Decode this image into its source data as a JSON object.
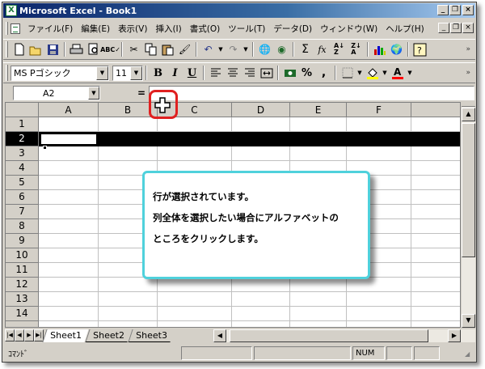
{
  "window": {
    "title": "Microsoft Excel - Book1",
    "app_icon": "excel-icon"
  },
  "menubar": {
    "items": [
      "ファイル(F)",
      "編集(E)",
      "表示(V)",
      "挿入(I)",
      "書式(O)",
      "ツール(T)",
      "データ(D)",
      "ウィンドウ(W)",
      "ヘルプ(H)"
    ]
  },
  "toolbar_standard": {
    "icons": [
      "new-icon",
      "open-icon",
      "save-icon",
      "print-icon",
      "print-preview-icon",
      "spelling-icon",
      "cut-icon",
      "copy-icon",
      "paste-icon",
      "format-painter-icon",
      "undo-icon",
      "redo-icon",
      "hyperlink-icon",
      "web-icon",
      "autosum-icon",
      "function-icon",
      "sort-ascending-icon",
      "sort-descending-icon",
      "chart-wizard-icon",
      "map-icon",
      "help-icon"
    ]
  },
  "toolbar_formatting": {
    "font_name": "MS Pゴシック",
    "font_size": "11",
    "bold_label": "B",
    "italic_label": "I",
    "underline_label": "U",
    "percent_label": "%",
    "comma_label": ","
  },
  "formula_bar": {
    "name_box": "A2",
    "equals_label": "=",
    "formula": ""
  },
  "sheet": {
    "columns": [
      "A",
      "B",
      "C",
      "D",
      "E",
      "F"
    ],
    "rows": [
      "1",
      "2",
      "3",
      "4",
      "5",
      "6",
      "7",
      "8",
      "9",
      "10",
      "11",
      "12",
      "13",
      "14",
      "15"
    ],
    "selected_row": "2",
    "active_cell": "A2"
  },
  "tabs": [
    "Sheet1",
    "Sheet2",
    "Sheet3"
  ],
  "active_tab": "Sheet1",
  "status": {
    "mode": "ｺﾏﾝﾄﾞ",
    "num": "NUM"
  },
  "callout": {
    "line1": "行が選択されています。",
    "line2": "列全体を選択したい場合にアルファベットの",
    "line3": "ところをクリックします。"
  },
  "colors": {
    "title_start": "#0a246a",
    "title_end": "#a6caf0",
    "callout_border": "#4fd1dc",
    "cursor_ring": "#e02020",
    "chrome": "#d4d0c8"
  }
}
